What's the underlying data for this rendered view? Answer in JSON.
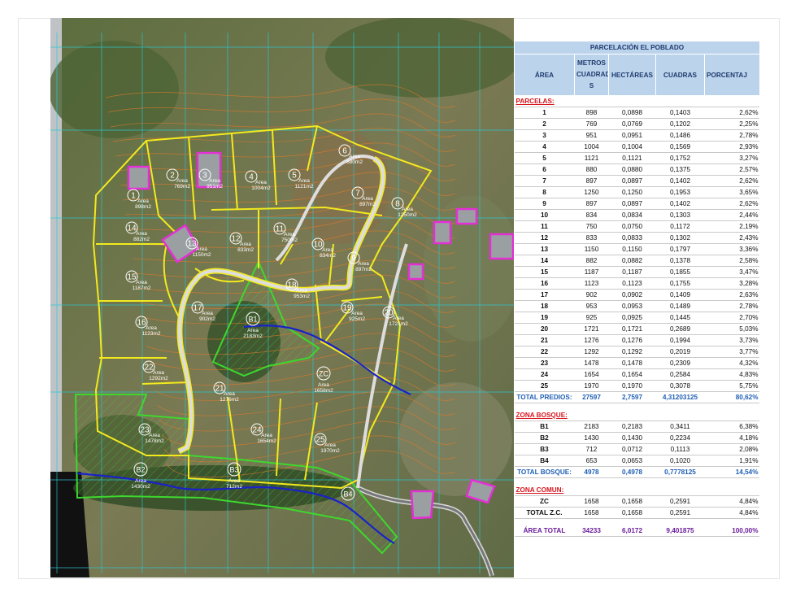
{
  "table": {
    "title": "PARCELACIÓN EL POBLADO",
    "headers": [
      "ÁREA",
      "METROS CUADRADO S",
      "HECTÁREAS",
      "CUADRAS",
      "PORCENTAJ"
    ],
    "parcelas_label": "PARCELAS:",
    "parcelas": [
      [
        "1",
        "898",
        "0,0898",
        "0,1403",
        "2,62%"
      ],
      [
        "2",
        "769",
        "0,0769",
        "0,1202",
        "2,25%"
      ],
      [
        "3",
        "951",
        "0,0951",
        "0,1486",
        "2,78%"
      ],
      [
        "4",
        "1004",
        "0,1004",
        "0,1569",
        "2,93%"
      ],
      [
        "5",
        "1121",
        "0,1121",
        "0,1752",
        "3,27%"
      ],
      [
        "6",
        "880",
        "0,0880",
        "0,1375",
        "2,57%"
      ],
      [
        "7",
        "897",
        "0,0897",
        "0,1402",
        "2,62%"
      ],
      [
        "8",
        "1250",
        "0,1250",
        "0,1953",
        "3,65%"
      ],
      [
        "9",
        "897",
        "0,0897",
        "0,1402",
        "2,62%"
      ],
      [
        "10",
        "834",
        "0,0834",
        "0,1303",
        "2,44%"
      ],
      [
        "11",
        "750",
        "0,0750",
        "0,1172",
        "2,19%"
      ],
      [
        "12",
        "833",
        "0,0833",
        "0,1302",
        "2,43%"
      ],
      [
        "13",
        "1150",
        "0,1150",
        "0,1797",
        "3,36%"
      ],
      [
        "14",
        "882",
        "0,0882",
        "0,1378",
        "2,58%"
      ],
      [
        "15",
        "1187",
        "0,1187",
        "0,1855",
        "3,47%"
      ],
      [
        "16",
        "1123",
        "0,1123",
        "0,1755",
        "3,28%"
      ],
      [
        "17",
        "902",
        "0,0902",
        "0,1409",
        "2,63%"
      ],
      [
        "18",
        "953",
        "0,0953",
        "0,1489",
        "2,78%"
      ],
      [
        "19",
        "925",
        "0,0925",
        "0,1445",
        "2,70%"
      ],
      [
        "20",
        "1721",
        "0,1721",
        "0,2689",
        "5,03%"
      ],
      [
        "21",
        "1276",
        "0,1276",
        "0,1994",
        "3,73%"
      ],
      [
        "22",
        "1292",
        "0,1292",
        "0,2019",
        "3,77%"
      ],
      [
        "23",
        "1478",
        "0,1478",
        "0,2309",
        "4,32%"
      ],
      [
        "24",
        "1654",
        "0,1654",
        "0,2584",
        "4,83%"
      ],
      [
        "25",
        "1970",
        "0,1970",
        "0,3078",
        "5,75%"
      ]
    ],
    "total_predios": [
      "TOTAL PREDIOS:",
      "27597",
      "2,7597",
      "4,31203125",
      "80,62%"
    ],
    "bosque_label": "ZONA BOSQUE:",
    "bosque": [
      [
        "B1",
        "2183",
        "0,2183",
        "0,3411",
        "6,38%"
      ],
      [
        "B2",
        "1430",
        "0,1430",
        "0,2234",
        "4,18%"
      ],
      [
        "B3",
        "712",
        "0,0712",
        "0,1113",
        "2,08%"
      ],
      [
        "B4",
        "653",
        "0,0653",
        "0,1020",
        "1,91%"
      ]
    ],
    "total_bosque": [
      "TOTAL BOSQUE:",
      "4978",
      "0,4978",
      "0,7778125",
      "14,54%"
    ],
    "comun_label": "ZONA COMUN:",
    "comun": [
      [
        "ZC",
        "1658",
        "0,1658",
        "0,2591",
        "4,84%"
      ]
    ],
    "total_zc": [
      "TOTAL Z.C.",
      "1658",
      "0,1658",
      "0,2591",
      "4,84%"
    ],
    "area_total": [
      "ÁREA TOTAL",
      "34233",
      "6,0172",
      "9,401875",
      "100,00%"
    ]
  },
  "map": {
    "area_prefix": "Area",
    "lots": [
      {
        "num": "1",
        "area": "898m2"
      },
      {
        "num": "2",
        "area": "769m2"
      },
      {
        "num": "3",
        "area": "951m2"
      },
      {
        "num": "4",
        "area": "1004m2"
      },
      {
        "num": "5",
        "area": "1121m2"
      },
      {
        "num": "6",
        "area": "880m2"
      },
      {
        "num": "7",
        "area": "897m2"
      },
      {
        "num": "8",
        "area": "1250m2"
      },
      {
        "num": "9",
        "area": "897m2"
      },
      {
        "num": "10",
        "area": "834m2"
      },
      {
        "num": "11",
        "area": "750m2"
      },
      {
        "num": "12",
        "area": "833m2"
      },
      {
        "num": "13",
        "area": "1150m2"
      },
      {
        "num": "14",
        "area": "882m2"
      },
      {
        "num": "15",
        "area": "1187m2"
      },
      {
        "num": "16",
        "area": "1123m2"
      },
      {
        "num": "17",
        "area": "902m2"
      },
      {
        "num": "18",
        "area": "953m2"
      },
      {
        "num": "19",
        "area": "925m2"
      },
      {
        "num": "20",
        "area": "1721m2"
      },
      {
        "num": "21",
        "area": "1276m2"
      },
      {
        "num": "22",
        "area": "1292m2"
      },
      {
        "num": "23",
        "area": "1478m2"
      },
      {
        "num": "24",
        "area": "1654m2"
      },
      {
        "num": "25",
        "area": "1970m2"
      }
    ],
    "zones": [
      {
        "code": "B1",
        "area": "2183m2"
      },
      {
        "code": "B2",
        "area": "1430m2"
      },
      {
        "code": "B3",
        "area": "712m2"
      },
      {
        "code": "B4",
        "area": ""
      },
      {
        "code": "ZC",
        "area": "1658m2"
      }
    ],
    "colors": {
      "lot_boundary": "#f2ea1e",
      "forest_boundary": "#3ed82e",
      "stream": "#1a22c8",
      "building": "#e52fd6",
      "contour": "#e07a2a",
      "grid": "#2bc7d4",
      "road": "#c8c8c8"
    }
  }
}
